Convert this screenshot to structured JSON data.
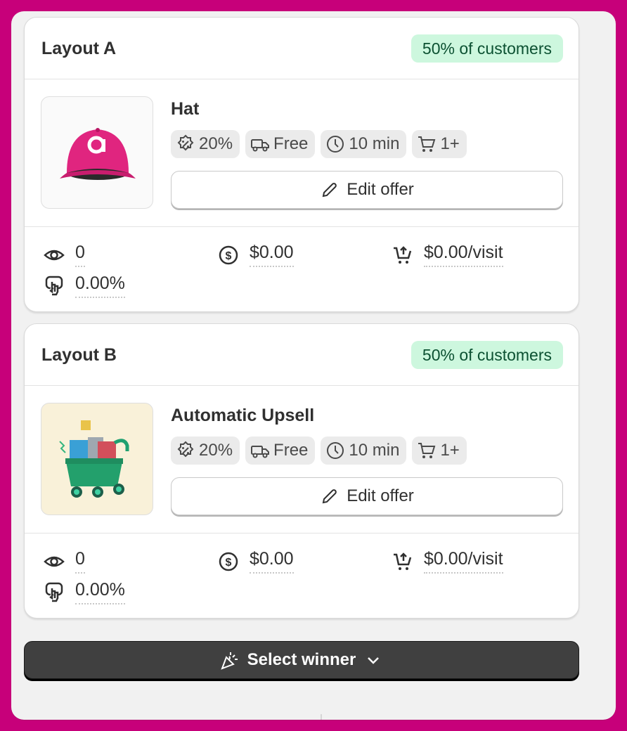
{
  "layouts": [
    {
      "title": "Layout A",
      "badge": "50% of customers",
      "product": "Hat",
      "chips": {
        "discount": "20%",
        "shipping": "Free",
        "time": "10 min",
        "qty": "1+"
      },
      "edit_label": "Edit offer",
      "stats": {
        "views": "0",
        "revenue": "$0.00",
        "rpv": "$0.00/visit",
        "ctr": "0.00%"
      }
    },
    {
      "title": "Layout B",
      "badge": "50% of customers",
      "product": "Automatic Upsell",
      "chips": {
        "discount": "20%",
        "shipping": "Free",
        "time": "10 min",
        "qty": "1+"
      },
      "edit_label": "Edit offer",
      "stats": {
        "views": "0",
        "revenue": "$0.00",
        "rpv": "$0.00/visit",
        "ctr": "0.00%"
      }
    }
  ],
  "select_winner_label": "Select winner",
  "colors": {
    "background": "#c7007a",
    "badge_bg": "#cdf7de",
    "badge_text": "#0c5132",
    "hat": "#e0257f",
    "primary_button": "#404040"
  }
}
